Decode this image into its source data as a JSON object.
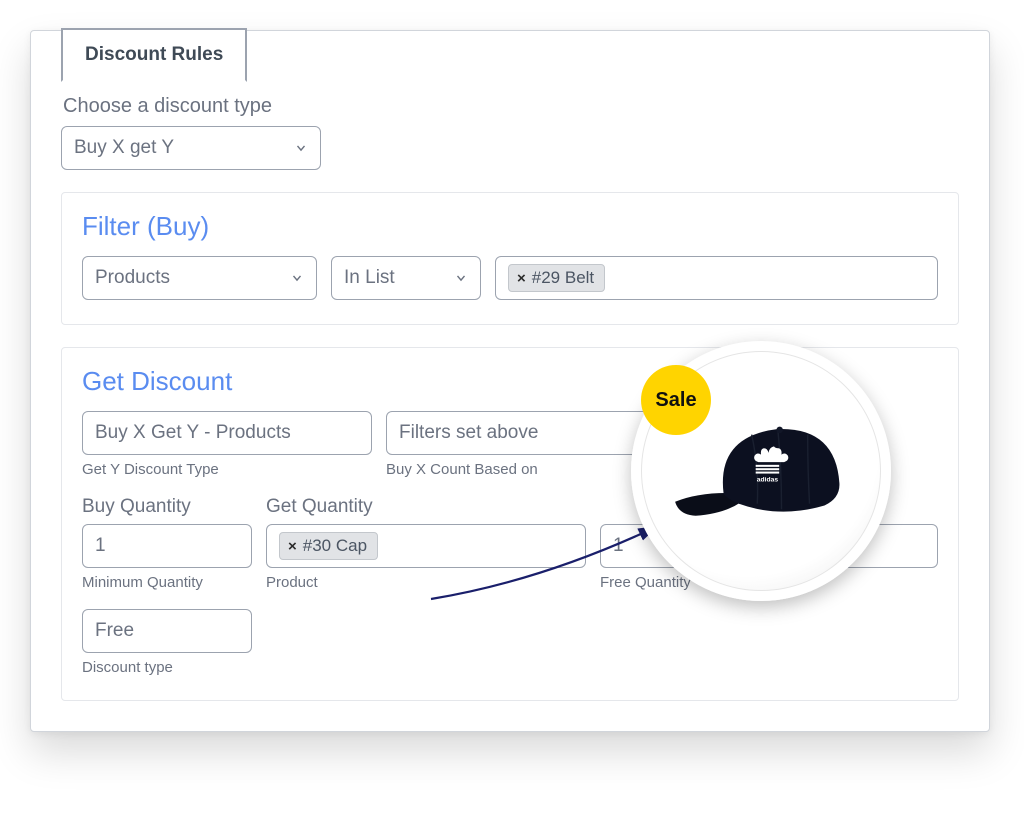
{
  "tab_label": "Discount Rules",
  "choose_label": "Choose a discount type",
  "discount_type_value": "Buy X get Y",
  "filter": {
    "title": "Filter (Buy)",
    "category_value": "Products",
    "operator_value": "In List",
    "chip_label": "#29 Belt"
  },
  "get": {
    "title": "Get Discount",
    "y_type_value": "Buy X Get Y - Products",
    "y_type_caption": "Get Y Discount Type",
    "based_on_value": "Filters set above",
    "based_on_caption": "Buy X Count Based on",
    "buy_qty_label": "Buy Quantity",
    "buy_qty_value": "1",
    "buy_qty_caption": "Minimum Quantity",
    "get_qty_label": "Get Quantity",
    "product_chip": "#30 Cap",
    "product_caption": "Product",
    "free_qty_value": "1",
    "free_qty_caption": "Free Quantity",
    "discount_type_value": "Free",
    "discount_type_caption": "Discount type"
  },
  "sale_badge": "Sale"
}
